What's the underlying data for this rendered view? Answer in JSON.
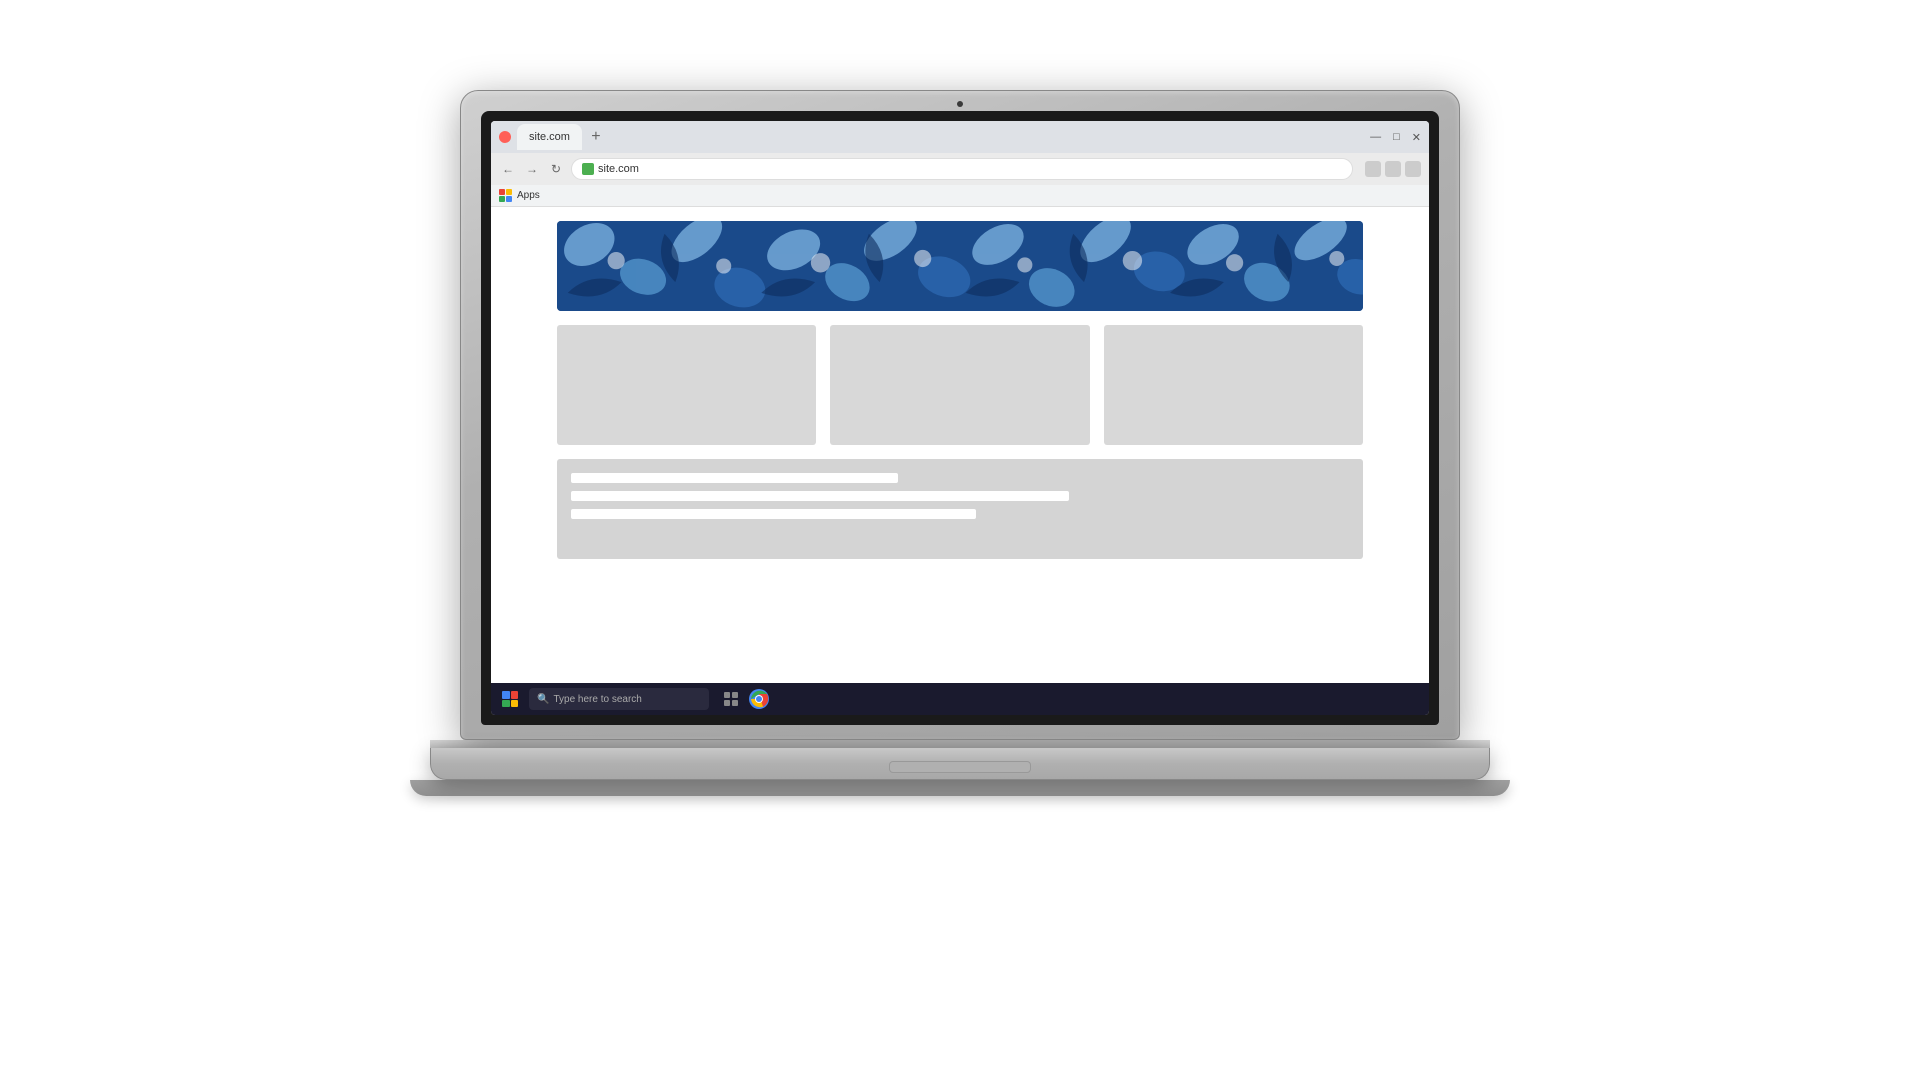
{
  "browser": {
    "tab_label": "site.com",
    "address": "site.com",
    "add_tab_label": "+",
    "window_controls": [
      "—",
      "□",
      "✕"
    ],
    "bookmarks_label": "Apps"
  },
  "taskbar": {
    "search_placeholder": "Type here to search"
  },
  "webpage": {
    "hero_alt": "Blue floral decorative banner",
    "cards": [
      "card1",
      "card2",
      "card3"
    ],
    "text_lines": [
      "short",
      "long",
      "medium"
    ]
  },
  "colors": {
    "hero_dark_blue": "#1a4a8a",
    "hero_mid_blue": "#2e6bb5",
    "hero_light_blue": "#87bce8",
    "taskbar_bg": "#1c2333",
    "chrome_green": "#34a853",
    "chrome_red": "#ea4335",
    "chrome_blue": "#4285f4",
    "chrome_yellow": "#fbbc05"
  }
}
